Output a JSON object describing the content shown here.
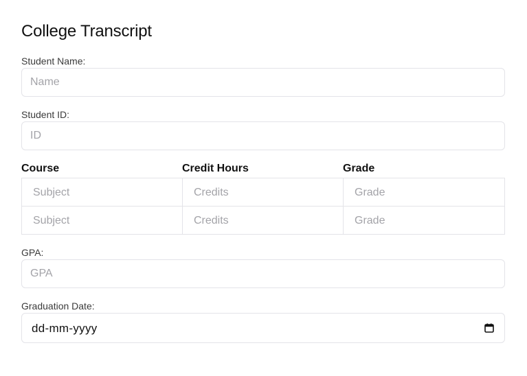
{
  "form": {
    "title": "College Transcript",
    "student_name": {
      "label": "Student Name:",
      "placeholder": "Name",
      "value": ""
    },
    "student_id": {
      "label": "Student ID:",
      "placeholder": "ID",
      "value": ""
    },
    "courses": {
      "headers": [
        "Course",
        "Credit Hours",
        "Grade"
      ],
      "rows": [
        {
          "course_placeholder": "Subject",
          "credits_placeholder": "Credits",
          "grade_placeholder": "Grade"
        },
        {
          "course_placeholder": "Subject",
          "credits_placeholder": "Credits",
          "grade_placeholder": "Grade"
        }
      ]
    },
    "gpa": {
      "label": "GPA:",
      "placeholder": "GPA",
      "value": ""
    },
    "graduation_date": {
      "label": "Graduation Date:",
      "value": "dd-mm-yyyy",
      "icon": "calendar-icon"
    }
  },
  "colors": {
    "border": "#e3e3e8",
    "placeholder": "#a3a3a8",
    "text": "#111111"
  }
}
